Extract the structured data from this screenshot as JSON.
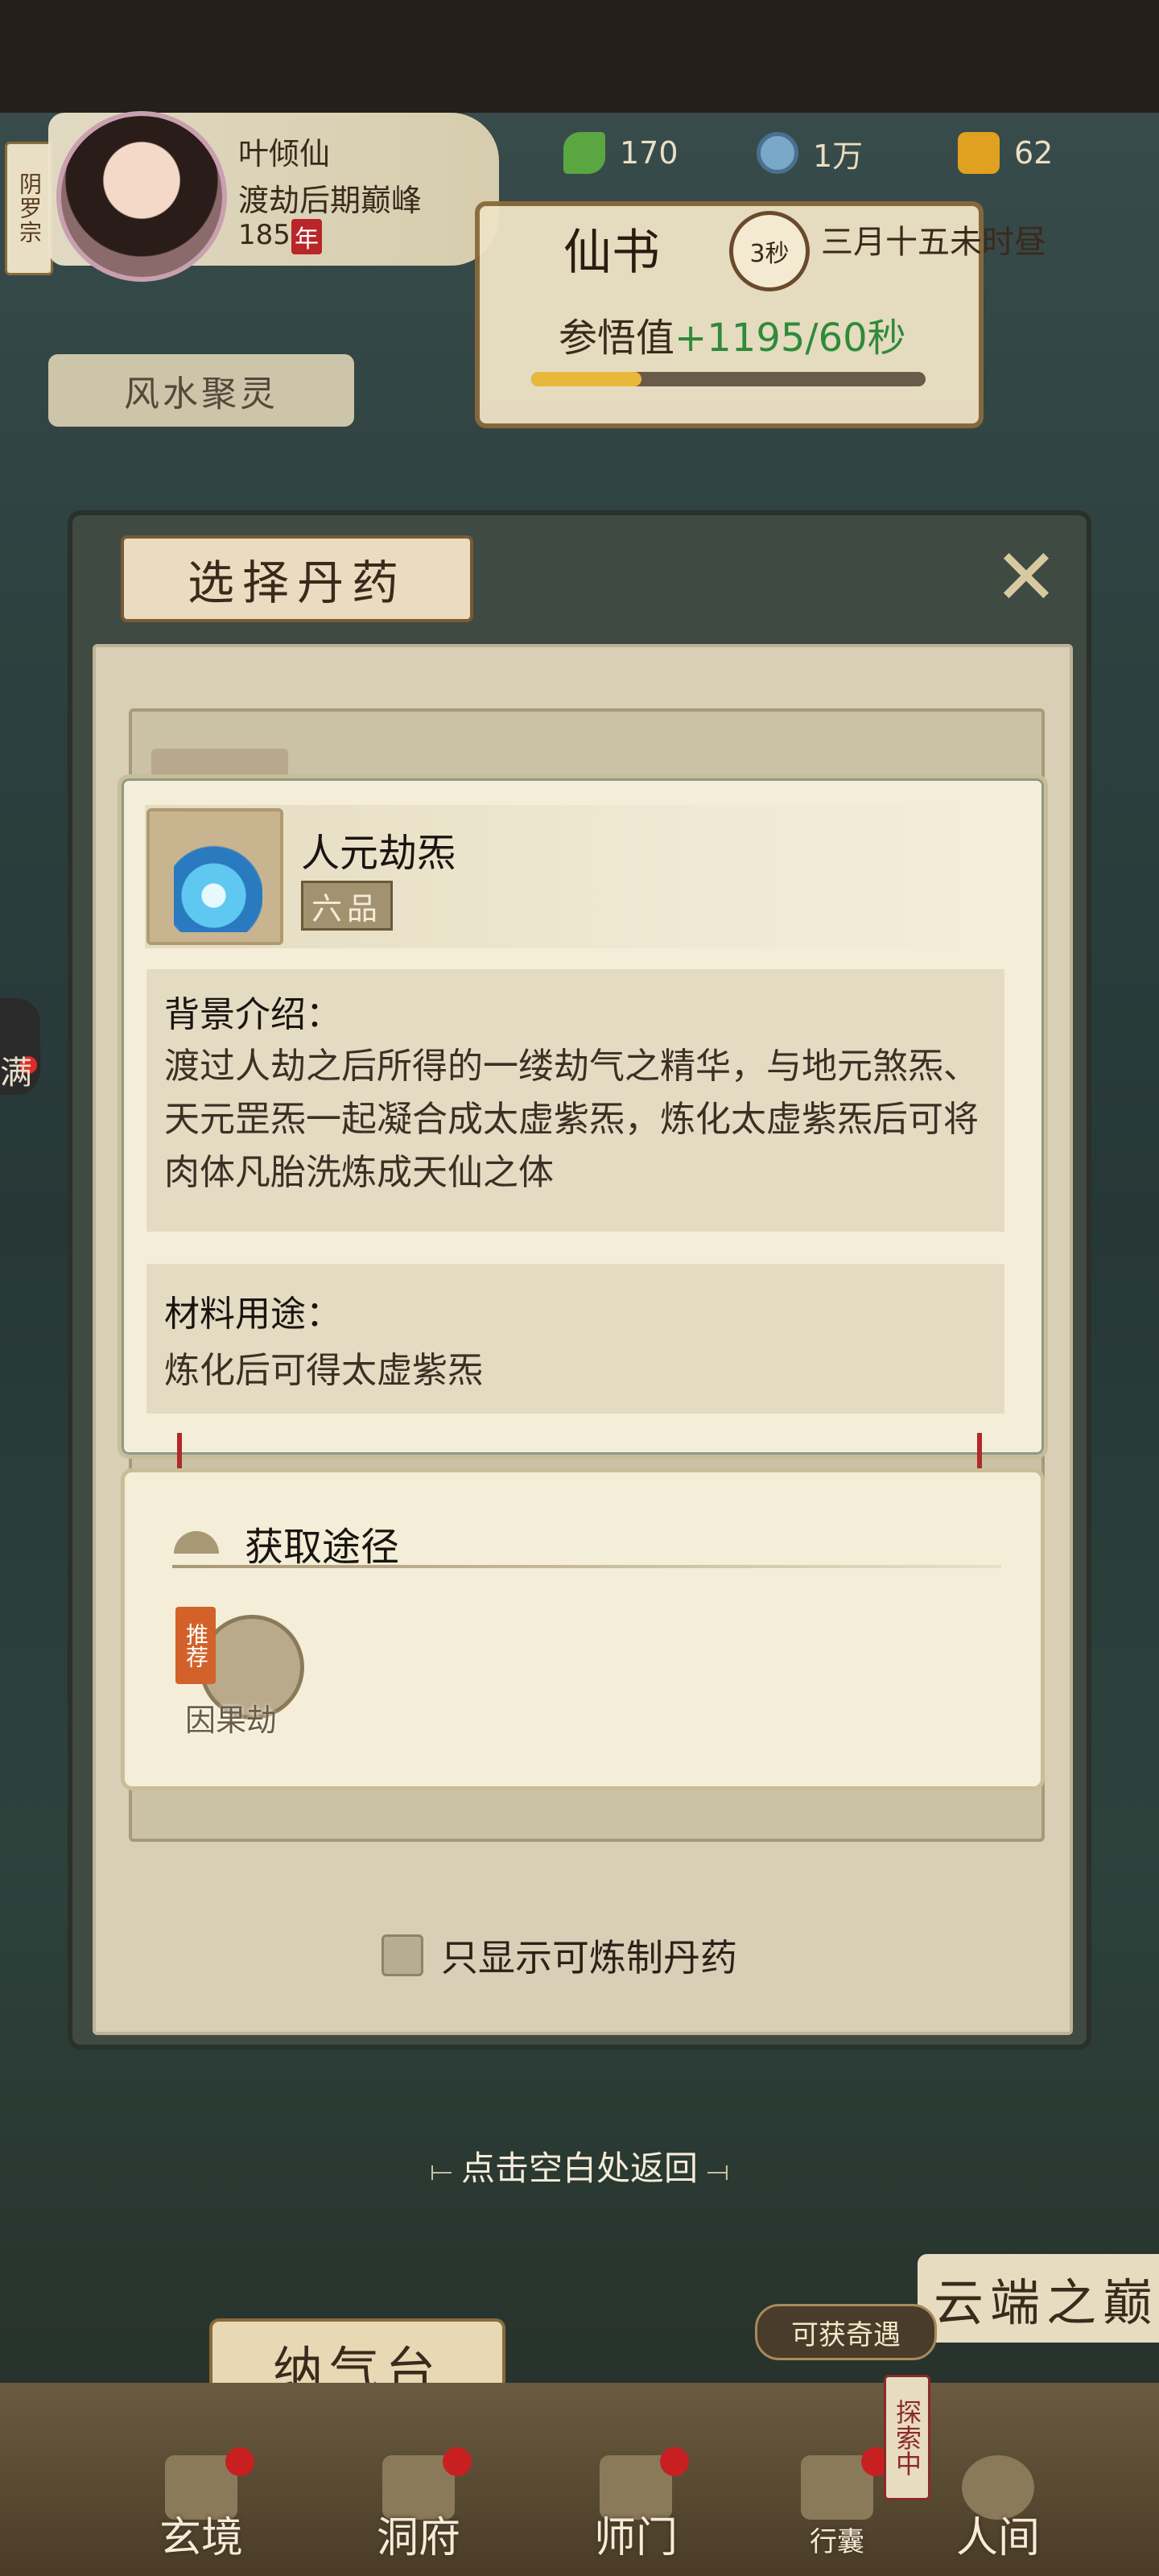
{
  "header": {
    "sect": "阴罗宗",
    "player_name": "叶倾仙",
    "realm": "渡劫后期巅峰",
    "age_value": "185",
    "age_unit": "年",
    "resources": [
      {
        "icon": "spirit-leaf-icon",
        "value": "170"
      },
      {
        "icon": "spirit-coin-icon",
        "value": "1万"
      },
      {
        "icon": "gold-ingot-icon",
        "value": "62"
      }
    ],
    "timer_title": "仙书",
    "timer_seconds": "3秒",
    "date": "三月十五未时昼",
    "insight_label": "参悟值",
    "insight_gain": "+1195/60秒",
    "insight_progress": 0.28,
    "fengshui_banner": "风水聚灵",
    "side_label": "满"
  },
  "dialog": {
    "title": "选择丹药",
    "close_icon": "close-x-icon",
    "filter_label": "只显示可炼制丹药",
    "filter_checked": false
  },
  "item_detail": {
    "name": "人元劫炁",
    "grade": "六品",
    "icon": "blue-flame-icon",
    "background_title": "背景介绍：",
    "background_text": "渡过人劫之后所得的一缕劫气之精华，与地元煞炁、天元罡炁一起凝合成太虚紫炁，炼化太虚紫炁后可将肉体凡胎洗炼成天仙之体",
    "usage_title": "材料用途：",
    "usage_text": "炼化后可得太虚紫炁"
  },
  "source": {
    "title": "获取途径",
    "entries": [
      {
        "badge": "推荐",
        "name": "因果劫"
      }
    ]
  },
  "return_hint": "点击空白处返回",
  "bottom": {
    "naqi_banner": "纳气台",
    "cloud_banner": "云端之巅",
    "encounter_tag": "可获奇遇",
    "explore_tag": "探索中",
    "nav": [
      {
        "label": "玄境"
      },
      {
        "label": "洞府"
      },
      {
        "label": "师门"
      },
      {
        "label": "行囊"
      },
      {
        "label": "人间"
      }
    ]
  },
  "colors": {
    "accent_green": "#2f8a3a",
    "grade_bg": "#a39270",
    "badge_red": "#d2622a",
    "notify_red": "#c82020"
  }
}
